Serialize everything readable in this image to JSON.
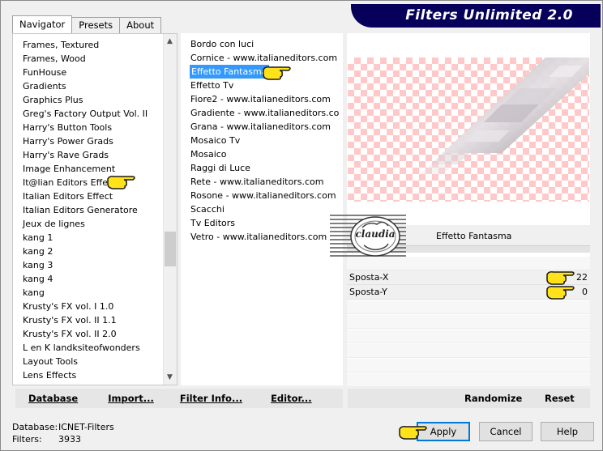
{
  "app": {
    "title": "Filters Unlimited 2.0"
  },
  "tabs": [
    {
      "label": "Navigator",
      "active": true
    },
    {
      "label": "Presets",
      "active": false
    },
    {
      "label": "About",
      "active": false
    }
  ],
  "categories": [
    "Frames, Textured",
    "Frames, Wood",
    "FunHouse",
    "Gradients",
    "Graphics Plus",
    "Greg's Factory Output Vol. II",
    "Harry's Button Tools",
    "Harry's Power Grads",
    "Harry's Rave Grads",
    "Image Enhancement",
    "It@lian Editors Effect",
    "Italian Editors Effect",
    "Italian Editors Generatore",
    "Jeux de lignes",
    "kang 1",
    "kang 2",
    "kang 3",
    "kang 4",
    "kang",
    "Krusty's FX vol. I 1.0",
    "Krusty's FX vol. II 1.1",
    "Krusty's FX vol. II 2.0",
    "L en K landksiteofwonders",
    "Layout Tools",
    "Lens Effects",
    "Lens Effects"
  ],
  "filters": [
    "Bordo con luci",
    "Cornice - www.italianeditors.com",
    "Effetto Fantasma",
    "Effetto Tv",
    "Fiore2 - www.italianeditors.com",
    "Gradiente - www.italianeditors.com",
    "Grana - www.italianeditors.com",
    "Mosaico Tv",
    "Mosaico",
    "Raggi di Luce",
    "Rete - www.italianeditors.com",
    "Rosone - www.italianeditors.com",
    "Scacchi",
    "Tv Editors",
    "Vetro - www.italianeditors.com"
  ],
  "selected_filter_index": 2,
  "left_buttons": {
    "database": "Database",
    "import": "Import...",
    "filter_info": "Filter Info...",
    "editor": "Editor..."
  },
  "filter_panel": {
    "title": "Effetto Fantasma"
  },
  "params": [
    {
      "label": "Sposta-X",
      "value": "22"
    },
    {
      "label": "Sposta-Y",
      "value": "0"
    }
  ],
  "right_buttons": {
    "randomize": "Randomize",
    "reset": "Reset"
  },
  "footer": {
    "database_label": "Database:",
    "database_value": "ICNET-Filters",
    "filters_label": "Filters:",
    "filters_value": "3933"
  },
  "dialog_buttons": {
    "apply": "Apply",
    "cancel": "Cancel",
    "help": "Help"
  },
  "watermark_text": "claudia",
  "colors": {
    "banner": "#06005a",
    "selection": "#3399ff",
    "checker": "#ffc9c9",
    "hand": "#ffe21a"
  }
}
